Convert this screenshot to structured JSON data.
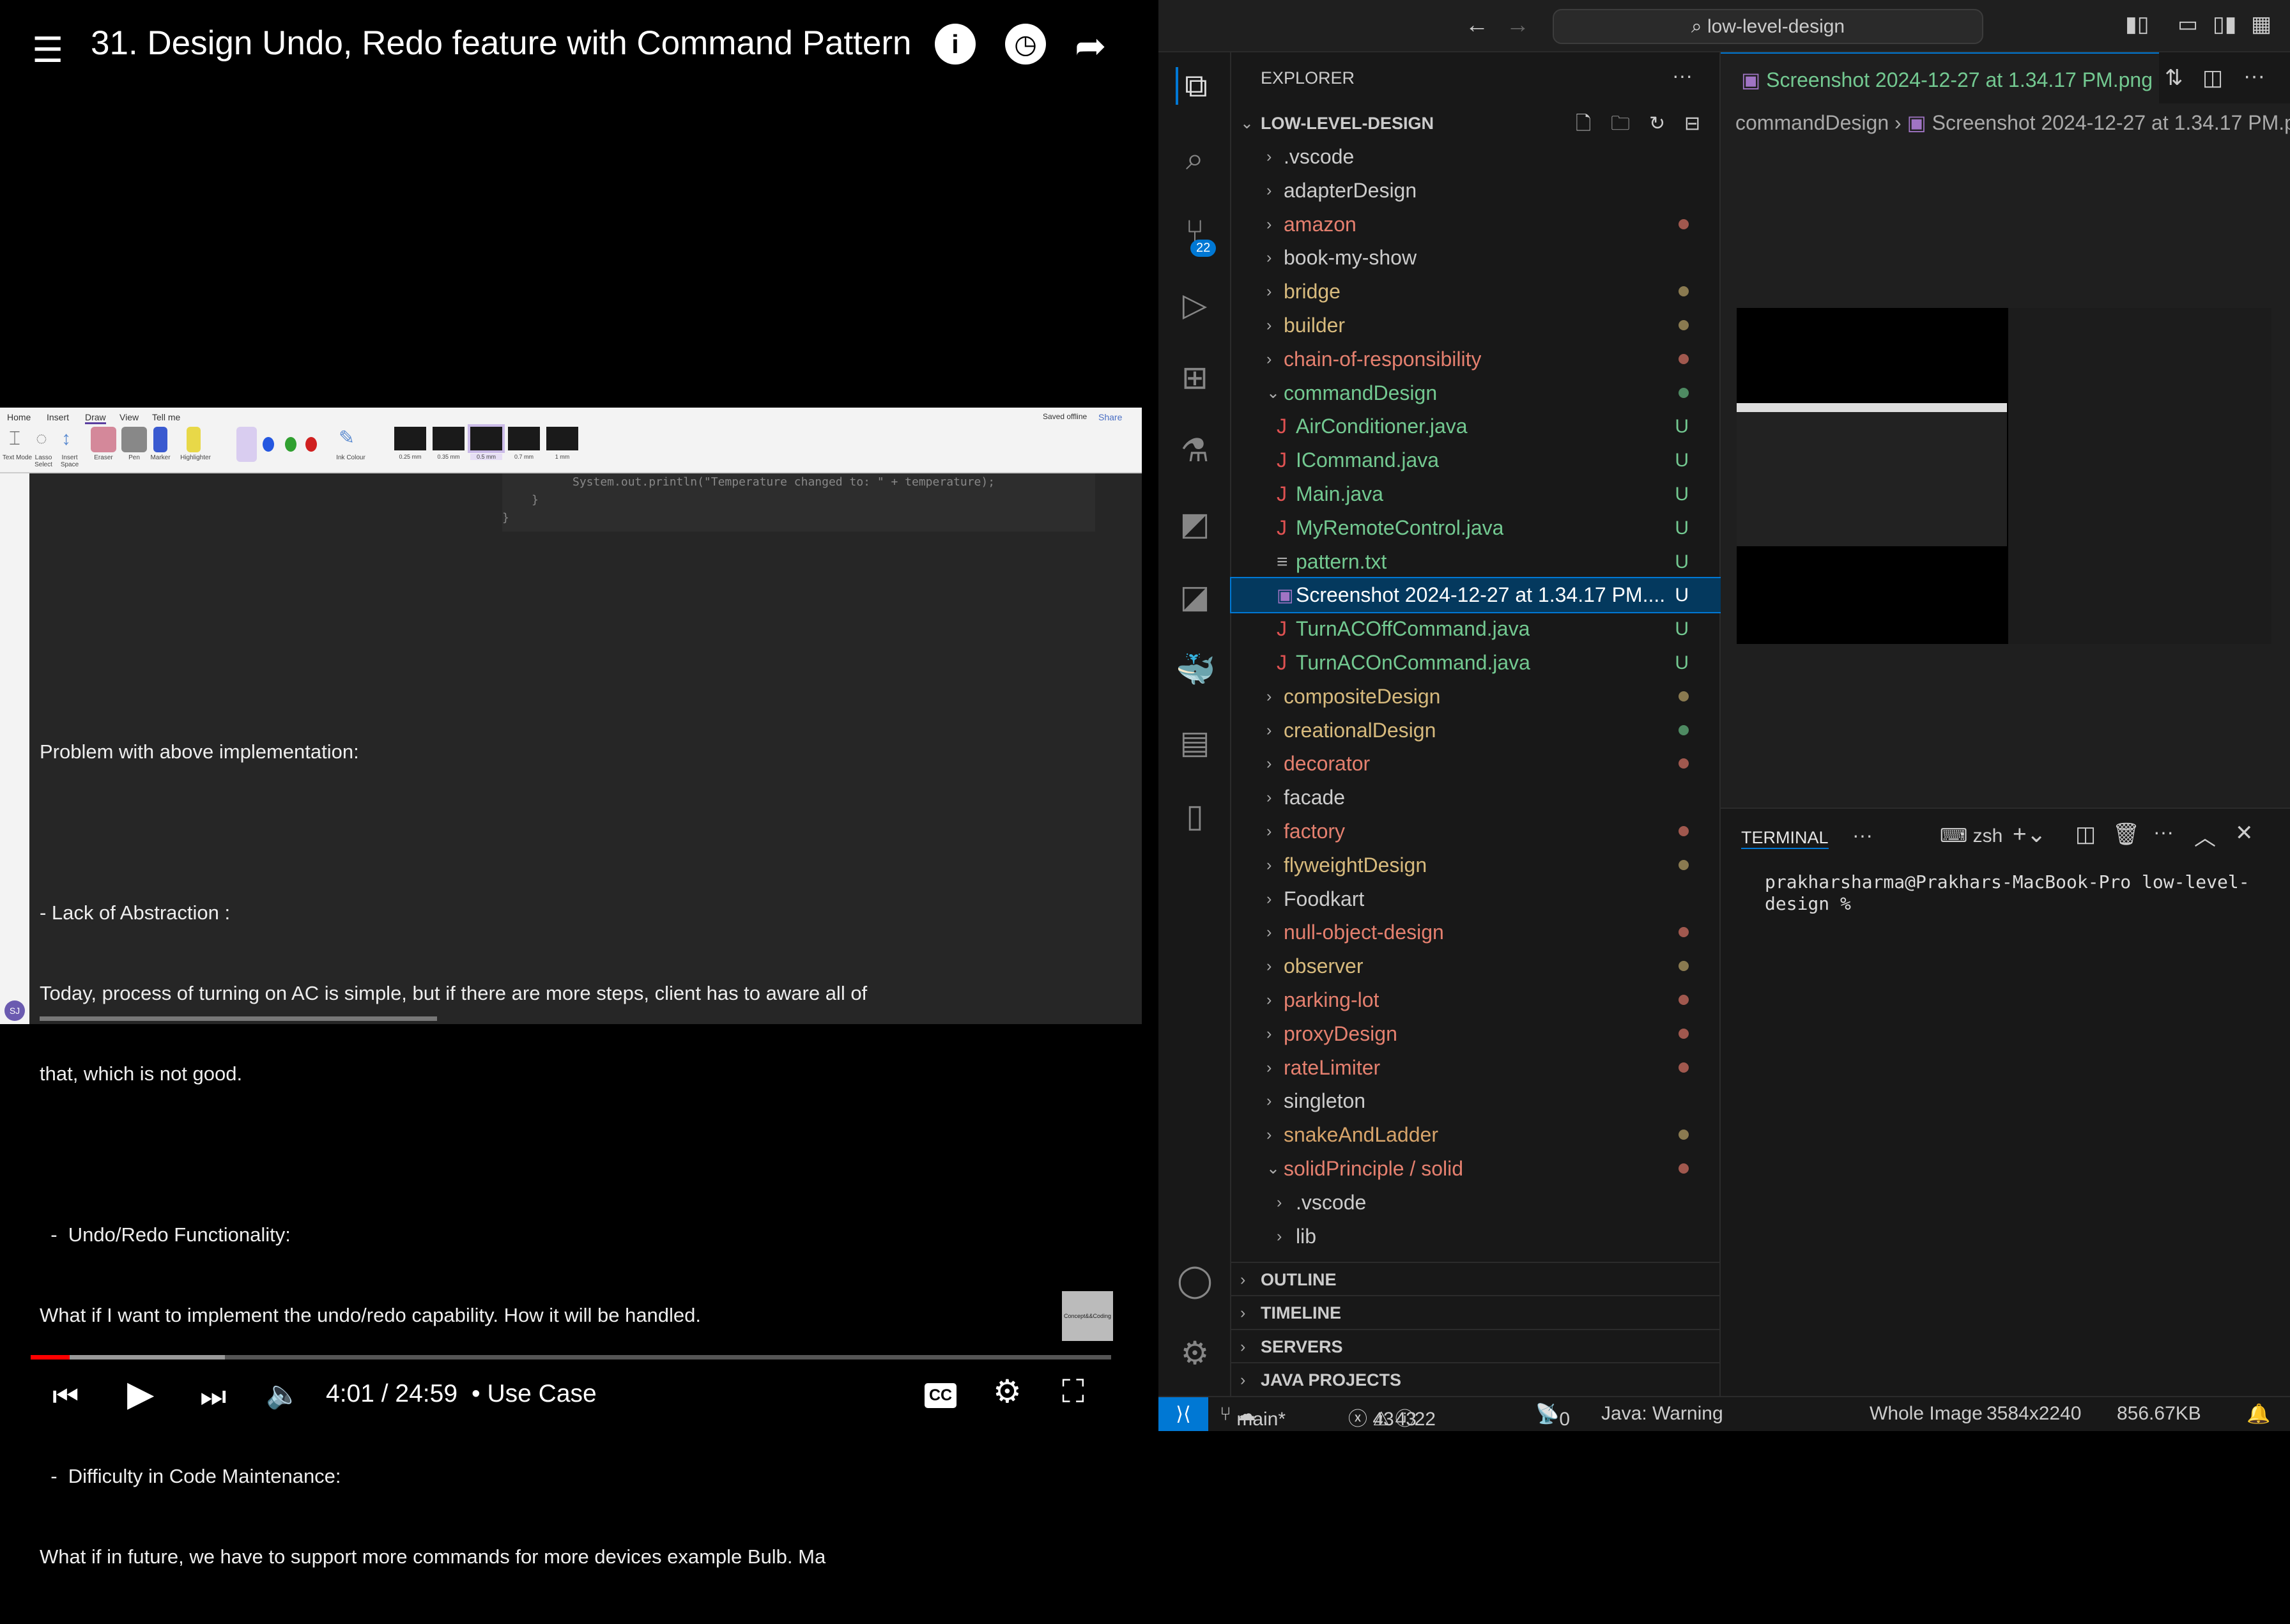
{
  "video": {
    "title": "31. Design Undo, Redo feature with Command Pattern",
    "ribbon_tabs": [
      "Home",
      "Insert",
      "Draw",
      "View",
      "Tell me"
    ],
    "ribbon_right": [
      "Saved offline",
      "Share"
    ],
    "tools": [
      "Text Mode",
      "Lasso Select",
      "Insert Space",
      "Eraser",
      "Pen",
      "Marker",
      "Highlighter",
      "Ink Colour"
    ],
    "pen_sizes": [
      "0.25 mm",
      "0.35 mm",
      "0.5 mm",
      "0.7 mm",
      "1 mm"
    ],
    "code_lines": [
      "System.out.println(\"Temperature changed to: \" + temperature);",
      "    }",
      "}"
    ],
    "notes": [
      "Problem with above implementation:",
      "",
      "- Lack of Abstraction :",
      "Today, process of turning on AC is simple, but if there are more steps, client has to aware all of",
      "that, which is not good.",
      "",
      "  -  Undo/Redo Functionality:",
      "What if I want to implement the undo/redo capability. How it will be handled.",
      "",
      "  -  Difficulty in Code Maintenance:",
      "What if in future, we have to support more commands for more devices example Bulb. Ma"
    ],
    "avatar": "SJ",
    "channel_logo": "Concept&&Coding",
    "time": "4:01 / 24:59",
    "chapter": "• Use Case",
    "played_fraction": 0.036,
    "buffered_fraction": 0.18
  },
  "vscode": {
    "search": "low-level-design",
    "explorer_title": "EXPLORER",
    "root": "LOW-LEVEL-DESIGN",
    "scm_badge": "22",
    "tree": [
      {
        "label": ".vscode",
        "type": "folder",
        "depth": 0,
        "color": "#cccccc"
      },
      {
        "label": "adapterDesign",
        "type": "folder",
        "depth": 0,
        "color": "#cccccc"
      },
      {
        "label": "amazon",
        "type": "folder",
        "depth": 0,
        "color": "#e5806f",
        "dot": "#a0584e"
      },
      {
        "label": "book-my-show",
        "type": "folder",
        "depth": 0,
        "color": "#cccccc"
      },
      {
        "label": "bridge",
        "type": "folder",
        "depth": 0,
        "color": "#d7ba7d",
        "dot": "#8a7a50"
      },
      {
        "label": "builder",
        "type": "folder",
        "depth": 0,
        "color": "#d7ba7d",
        "dot": "#8a7a50"
      },
      {
        "label": "chain-of-responsibility",
        "type": "folder",
        "depth": 0,
        "color": "#e5806f",
        "dot": "#a0584e"
      },
      {
        "label": "commandDesign",
        "type": "open",
        "depth": 0,
        "color": "#73c991",
        "dot": "#4e8a62"
      },
      {
        "label": "AirConditioner.java",
        "type": "java",
        "depth": 1,
        "color": "#73c991",
        "badge": "U"
      },
      {
        "label": "ICommand.java",
        "type": "java",
        "depth": 1,
        "color": "#73c991",
        "badge": "U"
      },
      {
        "label": "Main.java",
        "type": "java",
        "depth": 1,
        "color": "#73c991",
        "badge": "U"
      },
      {
        "label": "MyRemoteControl.java",
        "type": "java",
        "depth": 1,
        "color": "#73c991",
        "badge": "U"
      },
      {
        "label": "pattern.txt",
        "type": "txt",
        "depth": 1,
        "color": "#73c991",
        "badge": "U"
      },
      {
        "label": "Screenshot 2024-12-27 at 1.34.17 PM....",
        "type": "img",
        "depth": 1,
        "color": "#ffffff",
        "badge": "U",
        "selected": true
      },
      {
        "label": "TurnACOffCommand.java",
        "type": "java",
        "depth": 1,
        "color": "#73c991",
        "badge": "U"
      },
      {
        "label": "TurnACOnCommand.java",
        "type": "java",
        "depth": 1,
        "color": "#73c991",
        "badge": "U"
      },
      {
        "label": "compositeDesign",
        "type": "folder",
        "depth": 0,
        "color": "#d7ba7d",
        "dot": "#8a7a50"
      },
      {
        "label": "creationalDesign",
        "type": "folder",
        "depth": 0,
        "color": "#d7ba7d",
        "dot": "#4e8a62"
      },
      {
        "label": "decorator",
        "type": "folder",
        "depth": 0,
        "color": "#e5806f",
        "dot": "#a0584e"
      },
      {
        "label": "facade",
        "type": "folder",
        "depth": 0,
        "color": "#cccccc"
      },
      {
        "label": "factory",
        "type": "folder",
        "depth": 0,
        "color": "#e5806f",
        "dot": "#a0584e"
      },
      {
        "label": "flyweightDesign",
        "type": "folder",
        "depth": 0,
        "color": "#d7ba7d",
        "dot": "#8a7a50"
      },
      {
        "label": "Foodkart",
        "type": "folder",
        "depth": 0,
        "color": "#cccccc"
      },
      {
        "label": "null-object-design",
        "type": "folder",
        "depth": 0,
        "color": "#e5806f",
        "dot": "#a0584e"
      },
      {
        "label": "observer",
        "type": "folder",
        "depth": 0,
        "color": "#d7ba7d",
        "dot": "#8a7a50"
      },
      {
        "label": "parking-lot",
        "type": "folder",
        "depth": 0,
        "color": "#e5806f",
        "dot": "#a0584e"
      },
      {
        "label": "proxyDesign",
        "type": "folder",
        "depth": 0,
        "color": "#e5806f",
        "dot": "#a0584e"
      },
      {
        "label": "rateLimiter",
        "type": "folder",
        "depth": 0,
        "color": "#e5806f",
        "dot": "#a0584e"
      },
      {
        "label": "singleton",
        "type": "folder",
        "depth": 0,
        "color": "#cccccc"
      },
      {
        "label": "snakeAndLadder",
        "type": "folder",
        "depth": 0,
        "color": "#d7a46a",
        "dot": "#8a7a50"
      },
      {
        "label": "solidPrinciple / solid",
        "type": "open",
        "depth": 0,
        "color": "#e5806f",
        "dot": "#a0584e"
      },
      {
        "label": ".vscode",
        "type": "folder",
        "depth": 1,
        "color": "#cccccc"
      },
      {
        "label": "lib",
        "type": "folder",
        "depth": 1,
        "color": "#cccccc"
      }
    ],
    "sections": [
      "OUTLINE",
      "TIMELINE",
      "SERVERS",
      "JAVA PROJECTS"
    ],
    "tab": "Screenshot 2024-12-27 at 1.34.17 PM.png",
    "breadcrumb": [
      "commandDesign",
      "Screenshot 2024-12-27 at 1.34.17 PM.png"
    ],
    "terminal": {
      "title": "TERMINAL",
      "shell": "zsh",
      "prompt": "prakharsharma@Prakhars-MacBook-Pro low-level-design %"
    },
    "status": {
      "branch": "main*",
      "errors": "43",
      "warnings": "43",
      "infos": "22",
      "ports": "0",
      "java": "Java: Warning",
      "zoom": "Whole Image",
      "dims": "3584x2240",
      "size": "856.67KB"
    }
  }
}
